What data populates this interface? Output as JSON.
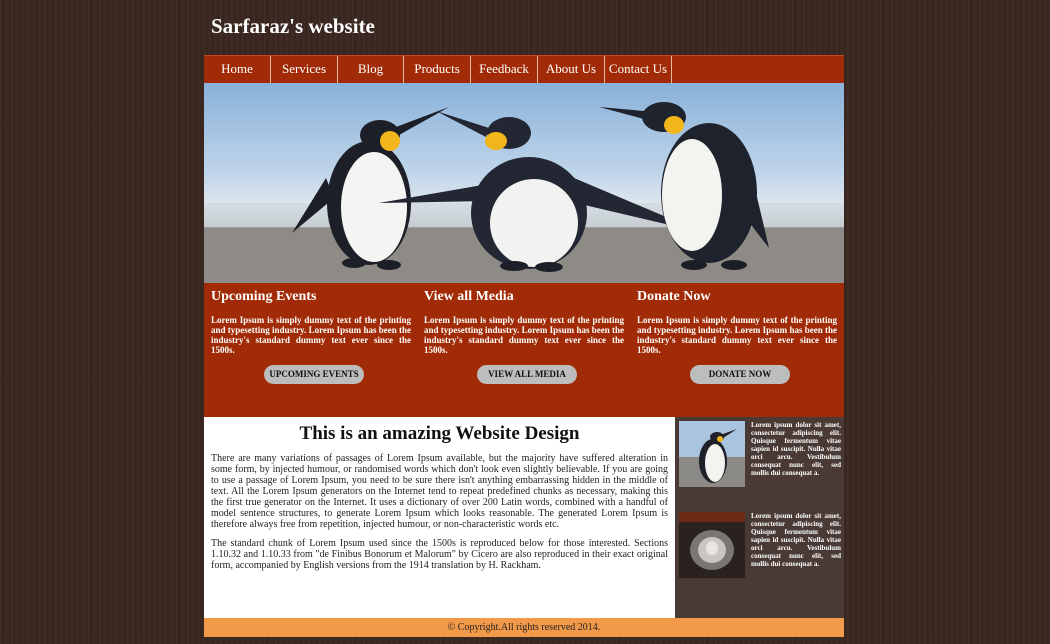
{
  "site": {
    "title": "Sarfaraz's website"
  },
  "nav": [
    "Home",
    "Services",
    "Blog",
    "Products",
    "Feedback",
    "About Us",
    "Contact Us"
  ],
  "columns": [
    {
      "title": "Upcoming Events",
      "text": "Lorem Ipsum is simply dummy text of the printing and typesetting industry. Lorem Ipsum has been the industry's standard dummy text ever since the 1500s.",
      "button": "UPCOMING EVENTS"
    },
    {
      "title": "View all Media",
      "text": "Lorem Ipsum is simply dummy text of the printing and typesetting industry. Lorem Ipsum has been the industry's standard dummy text ever since the 1500s.",
      "button": "VIEW ALL MEDIA"
    },
    {
      "title": "Donate Now",
      "text": "Lorem Ipsum is simply dummy text of the printing and typesetting industry. Lorem Ipsum has been the industry's standard dummy text ever since the 1500s.",
      "button": "DONATE NOW"
    }
  ],
  "main": {
    "heading": "This is an amazing Website Design",
    "paragraphs": [
      "There are many variations of passages of Lorem Ipsum available, but the majority have suffered alteration in some form, by injected humour, or randomised words which don't look even slightly believable. If you are going to use a passage of Lorem Ipsum, you need to be sure there isn't anything embarrassing hidden in the middle of text. All the Lorem Ipsum generators on the Internet tend to repeat predefined chunks as necessary, making this the first true generator on the Internet. It uses a dictionary of over 200 Latin words, combined with a handful of model sentence structures, to generate Lorem Ipsum which looks reasonable. The generated Lorem Ipsum is therefore always free from repetition, injected humour, or non-characteristic words etc.",
      "The standard chunk of Lorem Ipsum used since the 1500s is reproduced below for those interested. Sections 1.10.32 and 1.10.33 from \"de Finibus Bonorum et Malorum\" by Cicero are also reproduced in their exact original form, accompanied by English versions from the 1914 translation by H. Rackham."
    ]
  },
  "sidebar": [
    {
      "text": "Lorem ipsum dolor sit amet, consectetur adipiscing elit. Quisque fermentum vitae sapien id suscipit. Nulla vitae orci arcu. Vestibulum consequat nunc elit, sed mollis dui consequat a."
    },
    {
      "text": "Lorem ipsum dolor sit amet, consectetur adipiscing elit. Quisque fermentum vitae sapien id suscipit. Nulla vitae orci arcu. Vestibulum consequat nunc elit, sed mollis dui consequat a."
    }
  ],
  "footer": {
    "text": "© Copyright.All rights reserved 2014."
  },
  "colors": {
    "nav": "#a02b06",
    "panel": "#a02b06",
    "sidebar": "#4a3a36",
    "footer": "#f29a4a",
    "button": "#bdbdbd"
  }
}
